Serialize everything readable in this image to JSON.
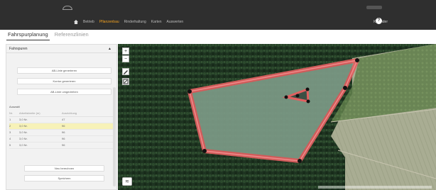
{
  "nav": {
    "items": [
      "Betrieb",
      "Pflanzenbau",
      "Rinderhaltung",
      "Karten",
      "Auswerten"
    ],
    "active_index": 1,
    "calendar_label": "Kalender",
    "help_symbol": "?"
  },
  "tabs": [
    "Fahrspurplanung",
    "Referenzlinien"
  ],
  "sidebar": {
    "header": "Fahrspuren",
    "collapse_symbol": "▲",
    "buttons": [
      "AB-Linie generieren",
      "Kontur generieren",
      "AB-Linie umgedrehen"
    ],
    "section_label": "Auswahl",
    "table_headers": [
      "Nr.",
      "Arbeitsbreite (m)",
      "Ausrichtung"
    ],
    "rows": [
      [
        "1",
        "3,0 Nr.",
        "47"
      ],
      [
        "2",
        "3,0 Nr.",
        "96"
      ],
      [
        "3",
        "3,0 Nr.",
        "96"
      ],
      [
        "4",
        "3,0 Nr.",
        "96"
      ],
      [
        "5",
        "3,0 Nr.",
        "96"
      ]
    ],
    "highlight_row": 1,
    "bottom_buttons": [
      "Neu berechnen",
      "Speichern"
    ]
  },
  "map": {
    "controls": [
      "+",
      "−"
    ],
    "boundary_color": "#e06060",
    "fill_color": "#9fb0a0"
  }
}
